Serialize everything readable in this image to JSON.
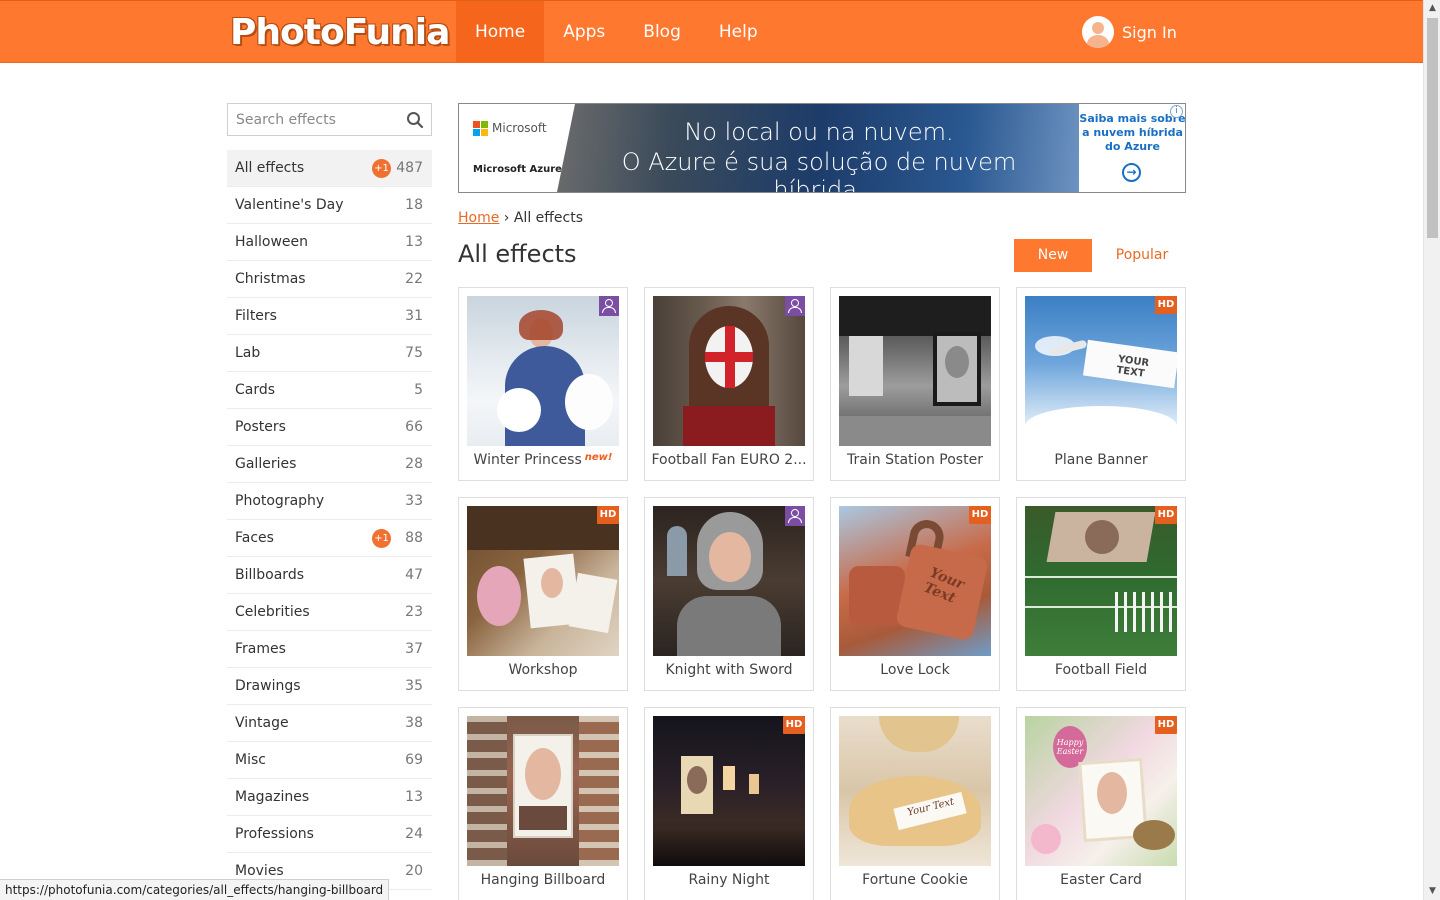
{
  "header": {
    "logo_text": "PhotoFunia",
    "nav": [
      {
        "label": "Home",
        "active": true
      },
      {
        "label": "Apps",
        "active": false
      },
      {
        "label": "Blog",
        "active": false
      },
      {
        "label": "Help",
        "active": false
      }
    ],
    "signin_label": "Sign In",
    "colors": {
      "bar": "#ff7830",
      "active_tab": "#f5651c"
    }
  },
  "search": {
    "placeholder": "Search effects",
    "value": ""
  },
  "categories": [
    {
      "label": "All effects",
      "count": "487",
      "badge": "+1",
      "active": true
    },
    {
      "label": "Valentine's Day",
      "count": "18"
    },
    {
      "label": "Halloween",
      "count": "13"
    },
    {
      "label": "Christmas",
      "count": "22"
    },
    {
      "label": "Filters",
      "count": "31"
    },
    {
      "label": "Lab",
      "count": "75"
    },
    {
      "label": "Cards",
      "count": "5"
    },
    {
      "label": "Posters",
      "count": "66"
    },
    {
      "label": "Galleries",
      "count": "28"
    },
    {
      "label": "Photography",
      "count": "33"
    },
    {
      "label": "Faces",
      "count": "88",
      "badge": "+1"
    },
    {
      "label": "Billboards",
      "count": "47"
    },
    {
      "label": "Celebrities",
      "count": "23"
    },
    {
      "label": "Frames",
      "count": "37"
    },
    {
      "label": "Drawings",
      "count": "35"
    },
    {
      "label": "Vintage",
      "count": "38"
    },
    {
      "label": "Misc",
      "count": "69"
    },
    {
      "label": "Magazines",
      "count": "13"
    },
    {
      "label": "Professions",
      "count": "24"
    },
    {
      "label": "Movies",
      "count": "20"
    }
  ],
  "ad": {
    "brand": "Microsoft",
    "product": "Microsoft Azure",
    "line1": "No local ou na nuvem.",
    "line2": "O Azure é sua solução de nuvem híbrida.",
    "cta": "Saiba mais sobre a nuvem híbrida do Azure",
    "info_glyph": "i",
    "arrow_glyph": "→"
  },
  "breadcrumb": {
    "home": "Home",
    "separator": "›",
    "current": "All effects"
  },
  "page_title": "All effects",
  "sort": {
    "new_label": "New",
    "popular_label": "Popular",
    "active": "New"
  },
  "effects": [
    {
      "title": "Winter Princess",
      "badge": "person",
      "new_label": "new!",
      "thumb": "winter"
    },
    {
      "title": "Football Fan EURO 2...",
      "badge": "person",
      "thumb": "football"
    },
    {
      "title": "Train Station Poster",
      "badge": "",
      "thumb": "train"
    },
    {
      "title": "Plane Banner",
      "badge": "HD",
      "thumb": "plane",
      "thumb_text": "YOUR TEXT"
    },
    {
      "title": "Workshop",
      "badge": "HD",
      "thumb": "workshop"
    },
    {
      "title": "Knight with Sword",
      "badge": "person",
      "thumb": "knight"
    },
    {
      "title": "Love Lock",
      "badge": "HD",
      "thumb": "lock",
      "thumb_text": "Your Text"
    },
    {
      "title": "Football Field",
      "badge": "HD",
      "thumb": "field"
    },
    {
      "title": "Hanging Billboard",
      "badge": "",
      "thumb": "hang"
    },
    {
      "title": "Rainy Night",
      "badge": "HD",
      "thumb": "rain"
    },
    {
      "title": "Fortune Cookie",
      "badge": "",
      "thumb": "cookie",
      "thumb_text": "Your Text"
    },
    {
      "title": "Easter Card",
      "badge": "HD",
      "thumb": "easter",
      "thumb_text": "Happy Easter"
    }
  ],
  "status_bar": "https://photofunia.com/categories/all_effects/hanging-billboard",
  "scrollbar": {
    "up": "▲",
    "down": "▼"
  }
}
